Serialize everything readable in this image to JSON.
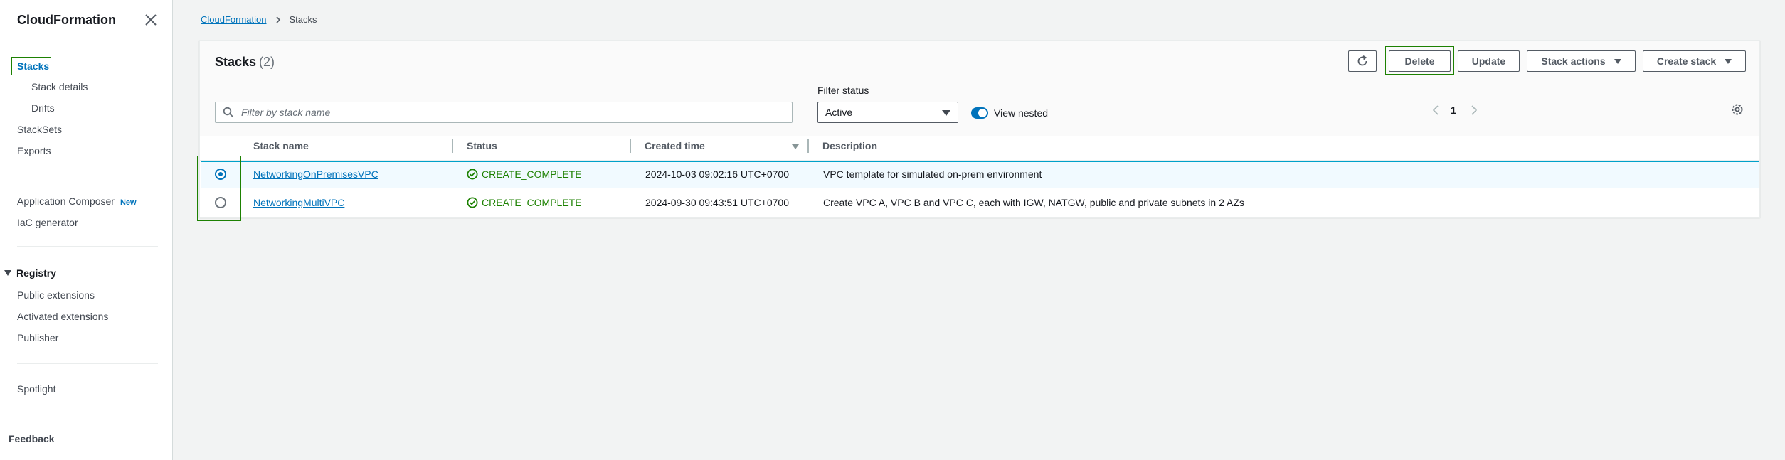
{
  "sidebar": {
    "title": "CloudFormation",
    "items": {
      "stacks": "Stacks",
      "stack_details": "Stack details",
      "drifts": "Drifts",
      "stacksets": "StackSets",
      "exports": "Exports",
      "application_composer": "Application Composer",
      "new_badge": "New",
      "iac_generator": "IaC generator"
    },
    "registry": {
      "label": "Registry",
      "public_extensions": "Public extensions",
      "activated_extensions": "Activated extensions",
      "publisher": "Publisher"
    },
    "spotlight": "Spotlight",
    "feedback": "Feedback"
  },
  "breadcrumb": {
    "root": "CloudFormation",
    "current": "Stacks"
  },
  "panel": {
    "title": "Stacks",
    "count": "(2)",
    "buttons": {
      "delete": "Delete",
      "update": "Update",
      "stack_actions": "Stack actions",
      "create_stack": "Create stack"
    },
    "search_placeholder": "Filter by stack name",
    "filter_status_label": "Filter status",
    "filter_status_value": "Active",
    "view_nested_label": "View nested",
    "view_nested_on": true,
    "page_number": "1"
  },
  "table": {
    "columns": {
      "name": "Stack name",
      "status": "Status",
      "created": "Created time",
      "description": "Description"
    },
    "rows": [
      {
        "name": "NetworkingOnPremisesVPC",
        "status": "CREATE_COMPLETE",
        "created": "2024-10-03 09:02:16 UTC+0700",
        "description": "VPC template for simulated on-prem environment",
        "selected": true
      },
      {
        "name": "NetworkingMultiVPC",
        "status": "CREATE_COMPLETE",
        "created": "2024-09-30 09:43:51 UTC+0700",
        "description": "Create VPC A, VPC B and VPC C, each with IGW, NATGW, public and private subnets in 2 AZs",
        "selected": false
      }
    ]
  },
  "icons": {
    "close": "close-icon",
    "chevron": "chevron-right-icon",
    "refresh": "refresh-icon",
    "search": "search-icon",
    "settings": "gear-icon",
    "status_ok": "check-circle-icon"
  },
  "colors": {
    "link": "#0073bb",
    "success": "#1d8102",
    "selection": "#00a1c9",
    "selected_row_bg": "#f1faff",
    "page_bg": "#f2f3f3"
  }
}
